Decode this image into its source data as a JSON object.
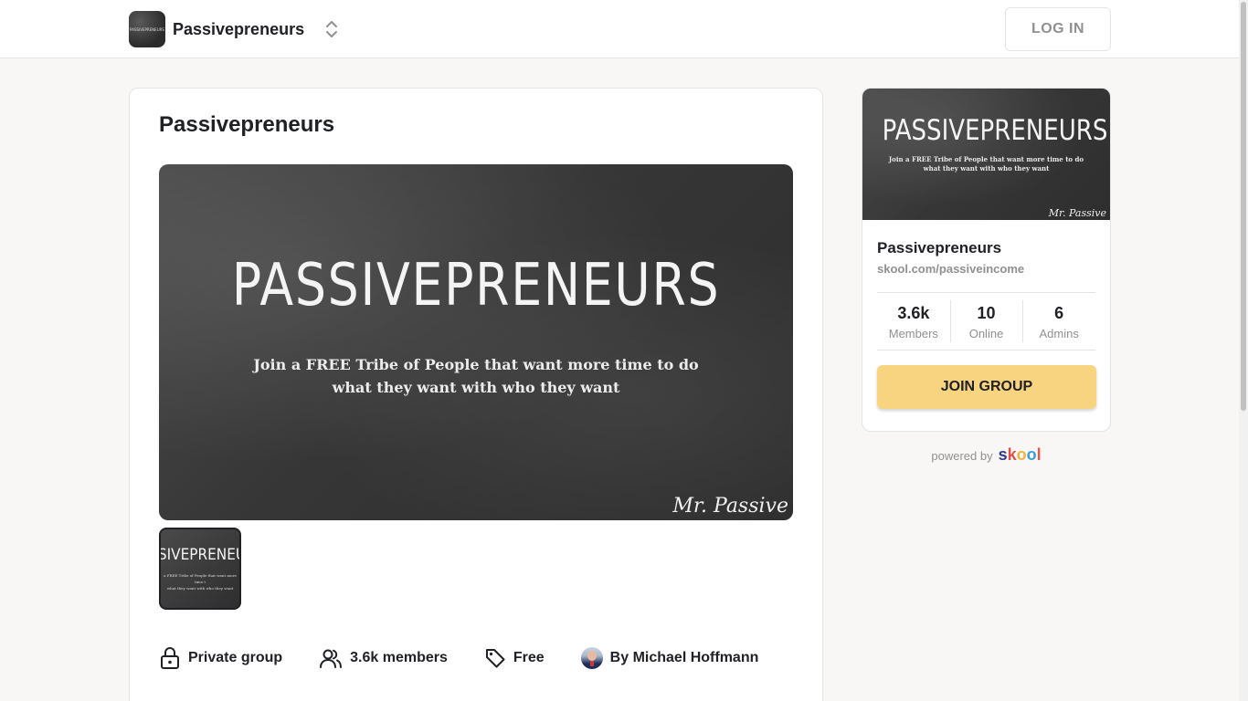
{
  "header": {
    "group_name": "Passivepreneurs",
    "logo_text": "PASSIVEPRENEURS",
    "login_label": "LOG IN"
  },
  "main": {
    "title": "Passivepreneurs",
    "hero": {
      "headline": "PASSIVEPRENEURS",
      "subline": "Join a FREE Tribe of People that want more time to do\nwhat they want with who they want",
      "signature": "Mr. Passive"
    },
    "thumbnail": {
      "headline": "SIVEPRENEU",
      "subline": "a FREE Tribe of People that want more time t\nwhat they want with who they want"
    },
    "meta": {
      "privacy": "Private group",
      "members": "3.6k members",
      "price": "Free",
      "owner": "By Michael Hoffmann"
    }
  },
  "sidebar": {
    "banner": {
      "headline": "PASSIVEPRENEURS",
      "subline": "Join a FREE Tribe of People that want more time to do\nwhat they want with who they want",
      "signature": "Mr. Passive"
    },
    "name": "Passivepreneurs",
    "url": "skool.com/passiveincome",
    "stats": [
      {
        "value": "3.6k",
        "label": "Members"
      },
      {
        "value": "10",
        "label": "Online"
      },
      {
        "value": "6",
        "label": "Admins"
      }
    ],
    "join_label": "JOIN GROUP"
  },
  "footer": {
    "powered_by": "powered by",
    "brand_letters": [
      "s",
      "k",
      "o",
      "o",
      "l"
    ]
  },
  "colors": {
    "join_button": "#f8d481",
    "muted_text": "#909090",
    "border": "#e4e4e4"
  }
}
